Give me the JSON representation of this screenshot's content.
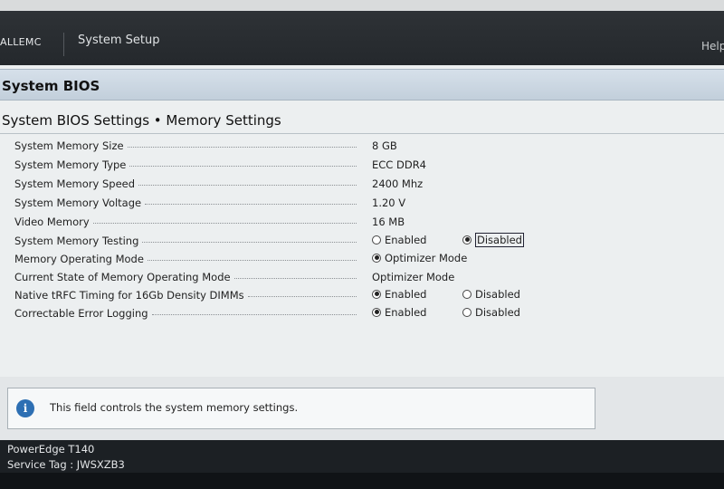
{
  "header": {
    "logo": "ALLEMC",
    "app_title": "System Setup",
    "help_label": "Help"
  },
  "page": {
    "title": "System BIOS",
    "subtitle": "System BIOS Settings • Memory Settings"
  },
  "settings": [
    {
      "label": "System Memory Size",
      "value": "8 GB"
    },
    {
      "label": "System Memory Type",
      "value": "ECC DDR4"
    },
    {
      "label": "System Memory Speed",
      "value": "2400 Mhz"
    },
    {
      "label": "System Memory Voltage",
      "value": "1.20 V"
    },
    {
      "label": "Video Memory",
      "value": "16 MB"
    },
    {
      "label": "System Memory Testing",
      "options": [
        "Enabled",
        "Disabled"
      ],
      "selected": "Disabled"
    },
    {
      "label": "Memory Operating Mode",
      "options": [
        "Optimizer Mode"
      ],
      "selected": "Optimizer Mode"
    },
    {
      "label": "Current State of Memory Operating Mode",
      "value": "Optimizer Mode"
    },
    {
      "label": "Native tRFC Timing for 16Gb Density DIMMs",
      "options": [
        "Enabled",
        "Disabled"
      ],
      "selected": "Enabled"
    },
    {
      "label": "Correctable Error Logging",
      "options": [
        "Enabled",
        "Disabled"
      ],
      "selected": "Enabled"
    }
  ],
  "help_box": {
    "icon": "info-icon",
    "text": "This field controls the system memory settings."
  },
  "footer": {
    "model": "PowerEdge T140",
    "service_tag": "Service Tag : JWSXZB3"
  },
  "colors": {
    "header_bg": "#2a2e32",
    "title_bar": "#c9d5e0",
    "content_bg": "#eceff0",
    "info_icon": "#2d6fb3"
  }
}
